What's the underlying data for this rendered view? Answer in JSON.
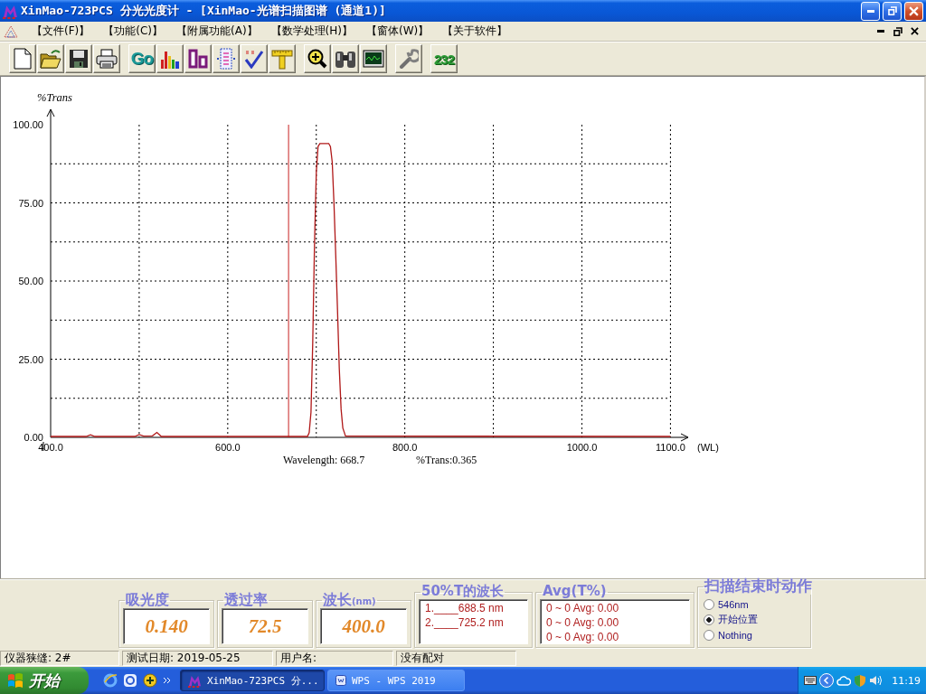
{
  "window": {
    "title": "XinMao-723PCS 分光光度计 - [XinMao-光谱扫描图谱 (通道1)]"
  },
  "menu": {
    "items": [
      "【文件(F)】",
      "【功能(C)】",
      "【附属功能(A)】",
      "【数学处理(H)】",
      "【窗体(W)】",
      "【关于软件】"
    ]
  },
  "toolbar": {
    "groups": [
      [
        {
          "kind": "new"
        },
        {
          "kind": "open"
        },
        {
          "kind": "save"
        },
        {
          "kind": "print"
        }
      ],
      [
        {
          "kind": "go",
          "label": "Go"
        },
        {
          "kind": "bars"
        },
        {
          "kind": "columns"
        },
        {
          "kind": "list"
        },
        {
          "kind": "check"
        },
        {
          "kind": "ruler"
        }
      ],
      [
        {
          "kind": "zoom"
        },
        {
          "kind": "binoculars"
        },
        {
          "kind": "monitor"
        }
      ],
      [
        {
          "kind": "wrench"
        }
      ],
      [
        {
          "kind": "port",
          "label": "232"
        }
      ]
    ]
  },
  "spectrum": {
    "readout": {
      "wavelength": "Wavelength: 668.7",
      "trans": "%Trans:0.365"
    },
    "chart_data": {
      "type": "line",
      "ylabel": "%Trans",
      "xlabel": "(WL)",
      "x": [
        400,
        440,
        445,
        450,
        495,
        500,
        505,
        515,
        520,
        525,
        600,
        690,
        692,
        694,
        696,
        698,
        700,
        702,
        704,
        714,
        716,
        718,
        720,
        722,
        724,
        726,
        728,
        730,
        733,
        1100
      ],
      "series": [
        {
          "color": "#b01818",
          "values": [
            0.3,
            0.3,
            0.8,
            0.3,
            0.3,
            0.9,
            0.4,
            0.5,
            1.6,
            0.3,
            0.3,
            0.3,
            1.5,
            8,
            30,
            62,
            85,
            93,
            94,
            94,
            93,
            88,
            75,
            58,
            40,
            22,
            9,
            3,
            0.4,
            0.3
          ]
        }
      ],
      "xlim": [
        400,
        1120
      ],
      "ylim": [
        0,
        100
      ],
      "xticks": [
        {
          "value": 400,
          "label": "400.0"
        },
        {
          "value": 600,
          "label": "600.0"
        },
        {
          "value": 800,
          "label": "800.0"
        },
        {
          "value": 1000,
          "label": "1000.0"
        },
        {
          "value": 1100,
          "label": "1100.0"
        }
      ],
      "yticks": [
        {
          "value": 0,
          "label": "0.00"
        },
        {
          "value": 25,
          "label": "25.00"
        },
        {
          "value": 50,
          "label": "50.00"
        },
        {
          "value": 75,
          "label": "75.00"
        },
        {
          "value": 100,
          "label": "100.00"
        }
      ],
      "grid": true,
      "ref_lines": [
        {
          "axis": "x",
          "value": 668.7,
          "color": "#c82020"
        }
      ]
    }
  },
  "readings": [
    {
      "label": "吸光度",
      "value": "0.140"
    },
    {
      "label": "透过率",
      "value": "72.5"
    },
    {
      "label": "波长",
      "unit": "(nm)",
      "value": "400.0"
    }
  ],
  "half_trans_wavelengths": {
    "title": "50%T的波长",
    "lines": [
      "1.____688.5 nm",
      "2.____725.2 nm"
    ]
  },
  "averages": {
    "title": "Avg(T%)",
    "lines": [
      "0 ~ 0 Avg: 0.00",
      "0 ~ 0 Avg: 0.00",
      "0 ~ 0 Avg: 0.00"
    ]
  },
  "end_action": {
    "title": "扫描结束时动作",
    "options": [
      {
        "label": "546nm",
        "selected": false
      },
      {
        "label": "开始位置",
        "selected": true
      },
      {
        "label": "Nothing",
        "selected": false
      }
    ]
  },
  "status_bar": [
    "仪器狭缝: 2#",
    "测试日期: 2019-05-25",
    "用户名:",
    "没有配对"
  ],
  "taskbar": {
    "start": "开始",
    "tasks": [
      {
        "label": "XinMao-723PCS 分...",
        "selected": true
      },
      {
        "label": "WPS - WPS 2019",
        "selected": false
      }
    ],
    "clock": "11:19"
  }
}
